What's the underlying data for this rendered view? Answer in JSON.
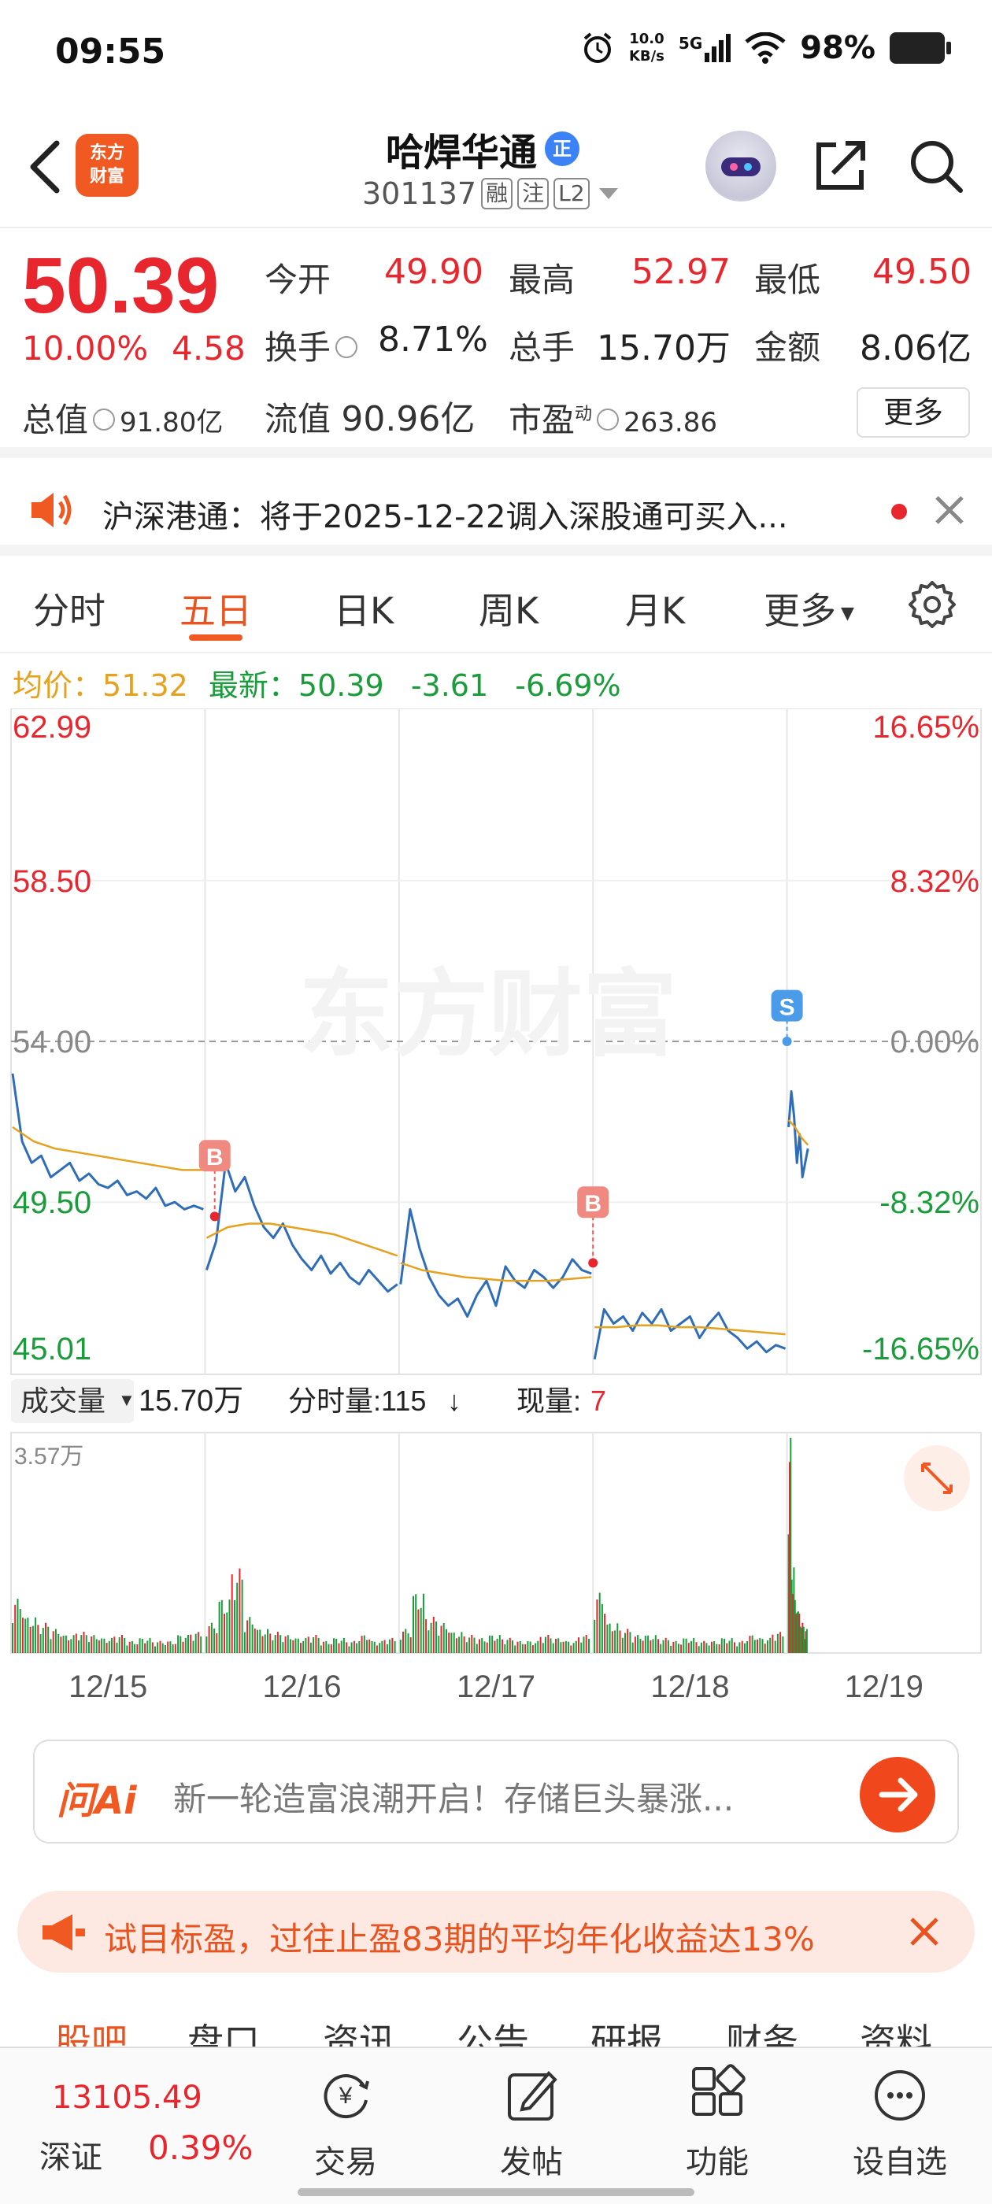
{
  "status_bar": {
    "time": "09:55",
    "net_speed_value": "10.0",
    "net_speed_unit": "KB/s",
    "signal_label": "5G",
    "battery": "98%"
  },
  "header": {
    "brand_line1": "东方",
    "brand_line2": "财富",
    "stock_name": "哈焊华通",
    "name_badge": "正",
    "stock_code": "301137",
    "tags": [
      "融",
      "注",
      "L2"
    ]
  },
  "quote": {
    "price": "50.39",
    "change_pct": "10.00%",
    "change_abs": "4.58",
    "fields": {
      "open_label": "今开",
      "open": "49.90",
      "high_label": "最高",
      "high": "52.97",
      "low_label": "最低",
      "low": "49.50",
      "turnover_label": "换手",
      "turnover": "8.71%",
      "volume_label": "总手",
      "volume": "15.70万",
      "amount_label": "金额",
      "amount": "8.06亿",
      "mktcap_label": "总值",
      "mktcap": "91.80亿",
      "float_label": "流值",
      "float": "90.96亿",
      "pe_label": "市盈",
      "pe_sup": "动",
      "pe": "263.86"
    },
    "more_button": "更多"
  },
  "notice": {
    "text": "沪深港通：将于2025-12-22调入深股通可买入..."
  },
  "tabs": {
    "items": [
      "分时",
      "五日",
      "日K",
      "周K",
      "月K",
      "更多"
    ],
    "active": "五日"
  },
  "summary": {
    "avg_label": "均价：",
    "avg_value": "51.32",
    "latest_label": "最新：",
    "latest_value": "50.39",
    "latest_change": "-3.61",
    "latest_pct": "-6.69%"
  },
  "chart_data": {
    "type": "line",
    "y_axis_left": [
      "62.99",
      "58.50",
      "54.00",
      "49.50",
      "45.01"
    ],
    "y_axis_right": [
      "16.65%",
      "8.32%",
      "0.00%",
      "-8.32%",
      "-16.65%"
    ],
    "ylim": [
      45.01,
      62.99
    ],
    "reference_price": 54.0,
    "x_labels": [
      "12/15",
      "12/16",
      "12/17",
      "12/18",
      "12/19"
    ],
    "watermark": "东方财富",
    "trade_markers": [
      {
        "label": "B",
        "day": "12/16",
        "price": 49.1
      },
      {
        "label": "B",
        "day": "12/17",
        "price": 47.8
      },
      {
        "label": "S",
        "day": "12/19",
        "price": 54.0
      }
    ],
    "series": [
      {
        "name": "价格",
        "segments": [
          [
            53.1,
            51.2,
            50.6,
            50.8,
            50.2,
            50.4,
            50.6,
            50.1,
            50.3,
            50.0,
            49.9,
            50.1,
            49.7,
            49.8,
            49.6,
            49.9,
            49.4,
            49.5,
            49.3,
            49.4,
            49.3
          ],
          [
            47.6,
            48.4,
            50.6,
            49.8,
            50.2,
            49.4,
            48.8,
            48.5,
            48.9,
            48.3,
            47.9,
            47.6,
            48.0,
            47.5,
            47.8,
            47.4,
            47.2,
            47.6,
            47.3,
            47.0,
            47.2
          ],
          [
            47.2,
            49.3,
            48.2,
            47.4,
            46.9,
            46.6,
            46.8,
            46.3,
            46.9,
            47.3,
            46.6,
            47.7,
            47.3,
            47.1,
            47.6,
            47.4,
            47.1,
            47.4,
            47.9,
            47.6,
            47.5
          ],
          [
            45.1,
            46.5,
            46.1,
            46.3,
            45.9,
            46.4,
            46.1,
            46.5,
            45.9,
            46.1,
            46.3,
            45.7,
            46.1,
            46.4,
            45.9,
            45.7,
            45.4,
            45.6,
            45.3,
            45.5,
            45.4
          ],
          [
            51.6,
            52.6,
            51.9,
            50.6,
            51.4,
            50.2,
            50.6,
            51.0
          ]
        ]
      },
      {
        "name": "均价",
        "segments": [
          [
            51.6,
            51.2,
            51.0,
            50.9,
            50.8,
            50.7,
            50.6,
            50.5,
            50.4,
            50.4
          ],
          [
            48.5,
            48.8,
            48.9,
            48.9,
            48.8,
            48.7,
            48.6,
            48.4,
            48.2,
            48.0
          ],
          [
            47.8,
            47.6,
            47.5,
            47.4,
            47.35,
            47.3,
            47.3,
            47.3,
            47.35,
            47.4
          ],
          [
            46.0,
            46.0,
            46.05,
            46.05,
            46.0,
            46.0,
            45.95,
            45.9,
            45.85,
            45.8
          ],
          [
            51.8,
            51.6,
            51.3,
            51.1
          ]
        ]
      }
    ]
  },
  "volume": {
    "label": "成交量",
    "total": "15.70万",
    "tick_label": "分时量:115",
    "tick_arrow": "↓",
    "current_label": "现量:",
    "current_value": "7",
    "ymax_label": "3.57万",
    "ymax": 3.57,
    "day_peaks": [
      [
        0.9,
        0.6,
        0.5,
        0.4,
        0.3,
        0.35,
        0.3,
        0.25,
        0.3,
        0.2,
        0.25,
        0.2,
        0.2,
        0.3,
        0.35
      ],
      [
        0.5,
        0.9,
        1.4,
        0.6,
        0.4,
        0.35,
        0.3,
        0.25,
        0.3,
        0.2,
        0.25,
        0.2,
        0.3,
        0.2,
        0.25
      ],
      [
        0.4,
        1.0,
        0.6,
        0.5,
        0.35,
        0.3,
        0.25,
        0.3,
        0.25,
        0.2,
        0.2,
        0.3,
        0.25,
        0.2,
        0.3
      ],
      [
        1.0,
        0.5,
        0.4,
        0.3,
        0.3,
        0.25,
        0.2,
        0.25,
        0.2,
        0.2,
        0.25,
        0.2,
        0.3,
        0.25,
        0.35
      ],
      [
        3.57,
        1.5,
        0.9,
        0.7,
        0.5,
        0.4
      ]
    ]
  },
  "ai_bar": {
    "logo": "问Ai",
    "text": "新一轮造富浪潮开启！存储巨头暴涨..."
  },
  "promo": {
    "text": "试目标盈，过往止盈83期的平均年化收益达13%"
  },
  "sub_tabs": [
    "股吧",
    "盘口",
    "资讯",
    "公告",
    "研报",
    "财务",
    "资料"
  ],
  "bottom_nav": {
    "index_value": "13105.49",
    "index_name": "深证",
    "index_pct": "0.39%",
    "items": [
      "交易",
      "发帖",
      "功能",
      "设自选"
    ]
  },
  "colors": {
    "up_red": "#e8262e",
    "down_green": "#1a9c3a",
    "brand_orange": "#f05a22",
    "price_line": "#2f6db8",
    "avg_line": "#e6a11e"
  }
}
